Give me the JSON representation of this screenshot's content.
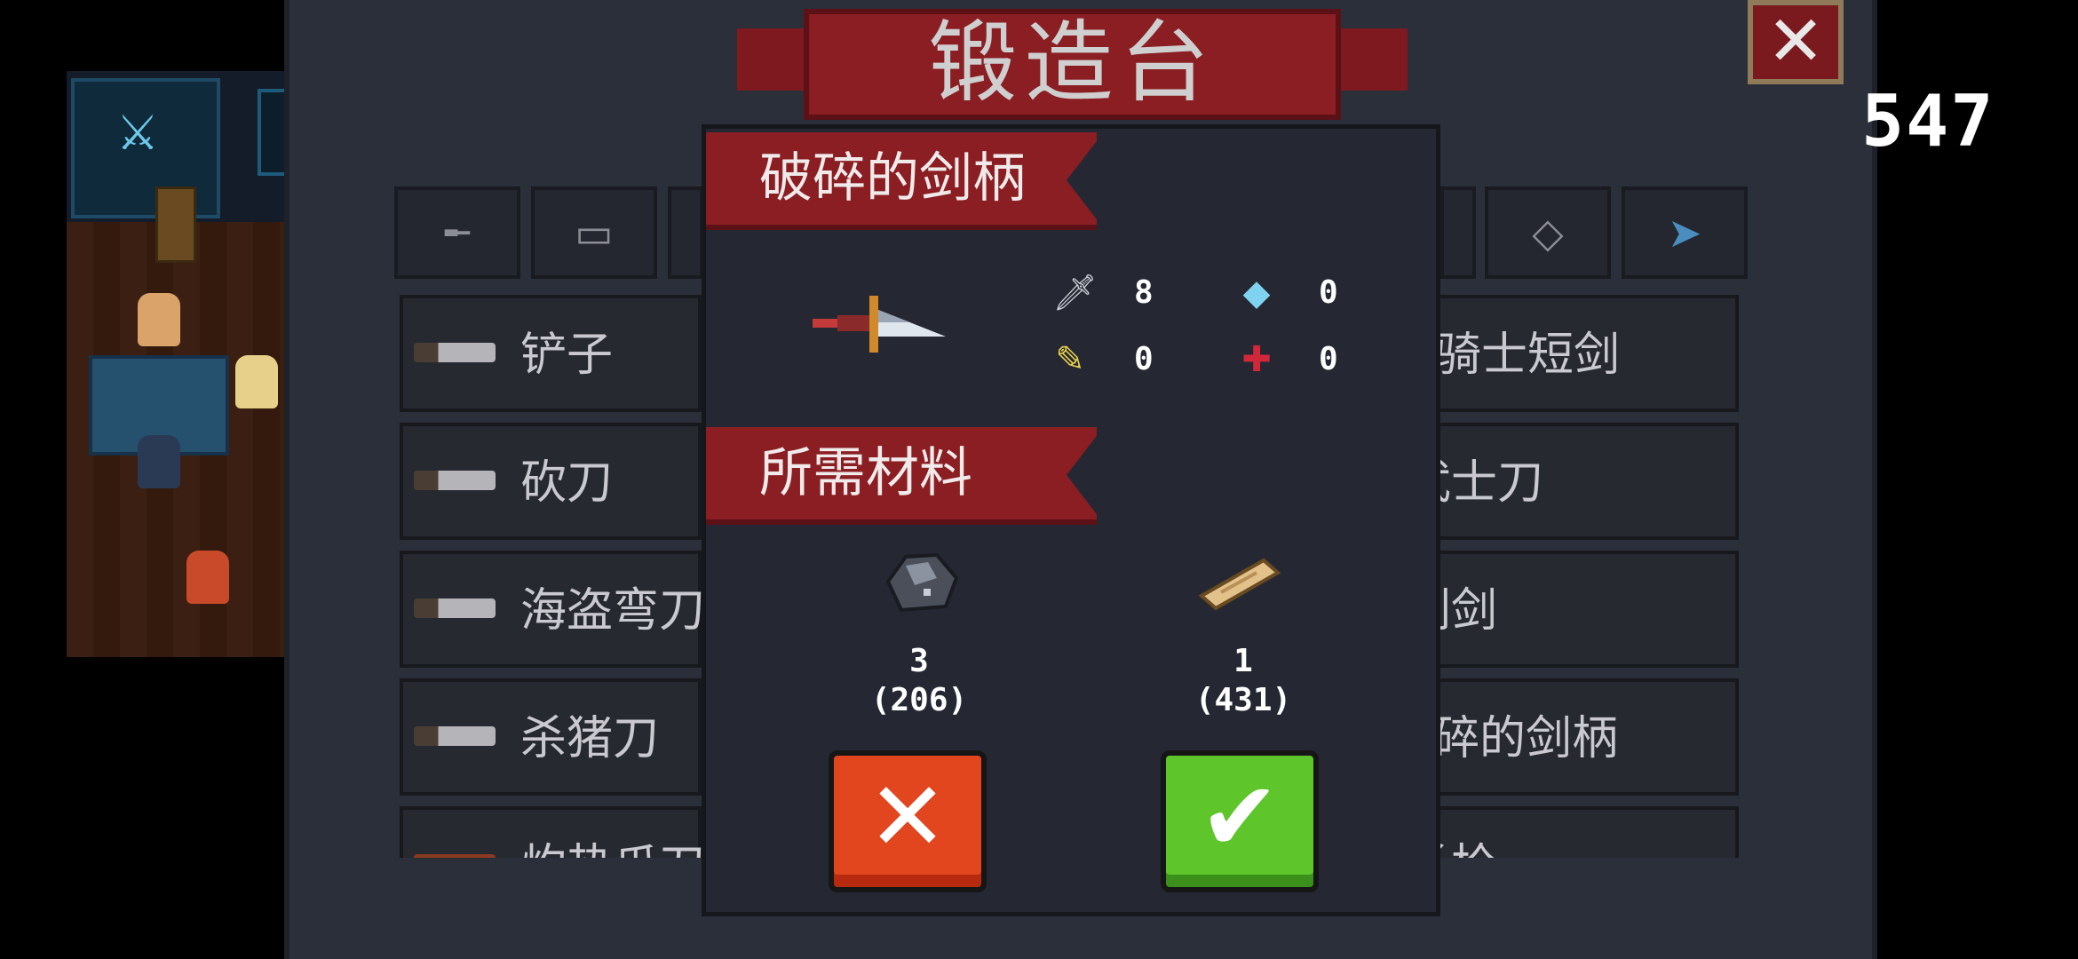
{
  "hud": {
    "number": "547"
  },
  "title": "锻造台",
  "close_label": "✕",
  "tabs": [
    {
      "icon": "pistol-icon",
      "glyph": "╾"
    },
    {
      "icon": "rifle-icon",
      "glyph": "▭"
    },
    {
      "icon": "sword-icon",
      "glyph": ""
    },
    {
      "icon": "fish-icon",
      "glyph": ""
    },
    {
      "icon": "crosshair-icon",
      "glyph": "◇"
    },
    {
      "icon": "shark-gun-icon",
      "glyph": "➤"
    }
  ],
  "weapons_left": [
    "铲子",
    "砍刀",
    "海盗弯刀",
    "杀猪刀",
    "灼热爪刀"
  ],
  "weapons_right": [
    "皇家骑士短剑",
    "武士刀",
    "刺剑",
    "破碎的剑柄",
    "长枪"
  ],
  "popup": {
    "item_name": "破碎的剑柄",
    "stats": {
      "attack": "8",
      "energy": "0",
      "crit": "0",
      "accuracy": "0"
    },
    "materials_title": "所需材料",
    "materials": [
      {
        "icon": "ore-icon",
        "required": "3",
        "owned": "(206)"
      },
      {
        "icon": "wood-icon",
        "required": "1",
        "owned": "(431)"
      }
    ],
    "cancel": "✕",
    "confirm": "✔"
  }
}
